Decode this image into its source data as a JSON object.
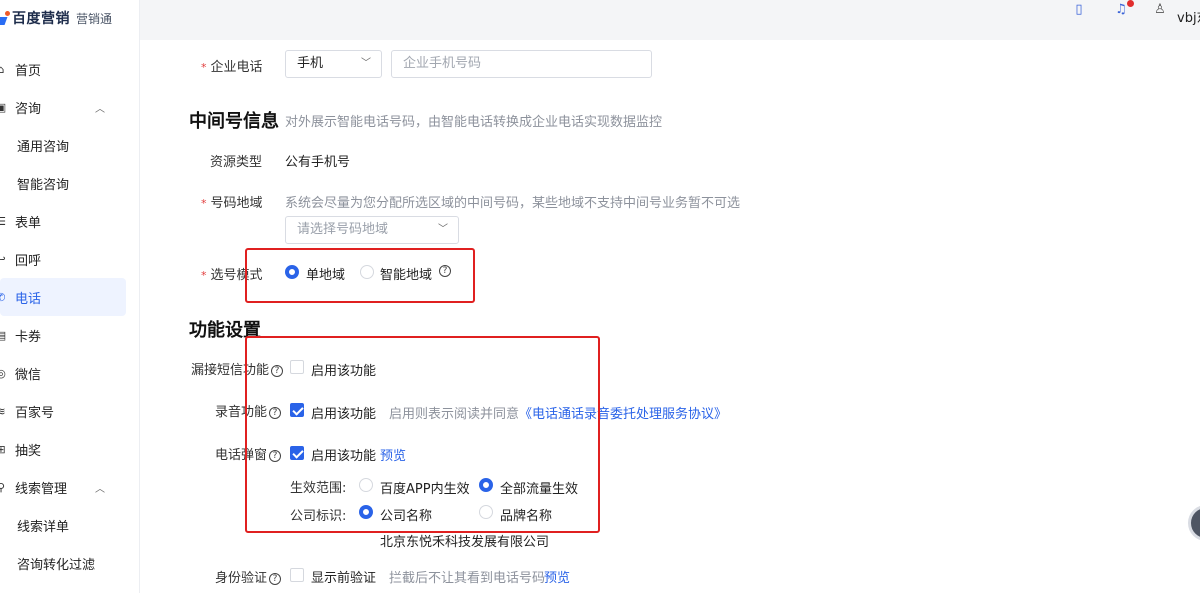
{
  "brand": {
    "name": "百度营销",
    "product": "营销通"
  },
  "sidebar": {
    "items": [
      {
        "label": "首页",
        "icon": "home-icon"
      },
      {
        "label": "咨询",
        "icon": "chat-icon"
      },
      {
        "label": "通用咨询"
      },
      {
        "label": "智能咨询"
      },
      {
        "label": "表单",
        "icon": "form-icon"
      },
      {
        "label": "回呼",
        "icon": "callback-icon"
      },
      {
        "label": "电话",
        "icon": "phone-icon"
      },
      {
        "label": "卡券",
        "icon": "coupon-icon"
      },
      {
        "label": "微信",
        "icon": "wechat-icon"
      },
      {
        "label": "百家号",
        "icon": "baijiahao-icon"
      },
      {
        "label": "抽奖",
        "icon": "gift-icon"
      },
      {
        "label": "线索管理",
        "icon": "leads-icon"
      },
      {
        "label": "线索详单"
      },
      {
        "label": "咨询转化过滤"
      }
    ]
  },
  "header": {
    "username": "vbj东"
  },
  "form": {
    "company_phone": {
      "label": "企业电话",
      "type_value": "手机",
      "placeholder": "企业手机号码"
    },
    "middle_number": {
      "title": "中间号信息",
      "desc": "对外展示智能电话号码，由智能电话转换成企业电话实现数据监控",
      "resource_type_label": "资源类型",
      "resource_type_value": "公有手机号",
      "region_label": "号码地域",
      "region_hint": "系统会尽量为您分配所选区域的中间号码，某些地域不支持中间号业务暂不可选",
      "region_placeholder": "请选择号码地域",
      "mode_label": "选号模式",
      "mode_options": [
        "单地域",
        "智能地域"
      ]
    },
    "features": {
      "title": "功能设置",
      "missed_sms_label": "漏接短信功能",
      "missed_sms_text": "启用该功能",
      "recording_label": "录音功能",
      "recording_text": "启用该功能",
      "recording_hint": "启用则表示阅读并同意",
      "recording_link": "《电话通话录音委托处理服务协议》",
      "popup_label": "电话弹窗",
      "popup_text": "启用该功能",
      "popup_preview": "预览",
      "scope_label": "生效范围:",
      "scope_options": [
        "百度APP内生效",
        "全部流量生效"
      ],
      "company_id_label": "公司标识:",
      "company_id_options": [
        "公司名称",
        "品牌名称"
      ],
      "company_name": "北京东悦禾科技发展有限公司",
      "identity_label": "身份验证",
      "identity_text": "显示前验证",
      "identity_hint": "拦截后不让其看到电话号码",
      "identity_preview": "预览"
    }
  }
}
